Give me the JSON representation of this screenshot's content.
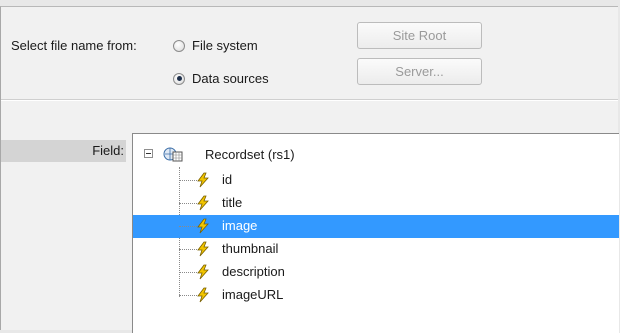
{
  "source": {
    "label": "Select file name from:",
    "options": [
      {
        "label": "File system",
        "checked": false
      },
      {
        "label": "Data sources",
        "checked": true
      }
    ]
  },
  "buttons": {
    "site_root": "Site Root",
    "server": "Server..."
  },
  "field": {
    "label": "Field:"
  },
  "tree": {
    "root": {
      "label": "Recordset (rs1)",
      "expanded": true,
      "icon": "recordset-icon"
    },
    "items": [
      {
        "label": "id",
        "icon": "lightning-bolt-icon",
        "selected": false
      },
      {
        "label": "title",
        "icon": "lightning-bolt-icon",
        "selected": false
      },
      {
        "label": "image",
        "icon": "lightning-bolt-icon",
        "selected": true
      },
      {
        "label": "thumbnail",
        "icon": "lightning-bolt-icon",
        "selected": false
      },
      {
        "label": "description",
        "icon": "lightning-bolt-icon",
        "selected": false
      },
      {
        "label": "imageURL",
        "icon": "lightning-bolt-icon",
        "selected": false
      }
    ]
  },
  "colors": {
    "selection": "#3399ff",
    "bolt_fill": "#f2c500",
    "bolt_stroke": "#7a6000"
  }
}
